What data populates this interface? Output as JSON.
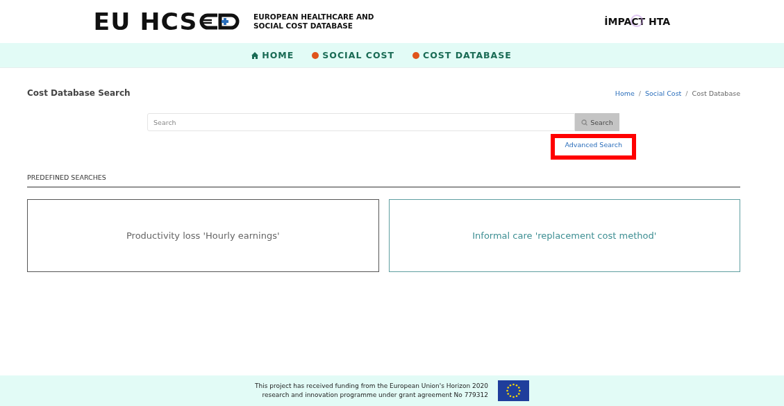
{
  "header": {
    "logo_text": "EU HCS",
    "logo_caption": [
      "EUROPEAN HEALTHCARE AND",
      "SOCIAL COST DATABASE"
    ],
    "partner_logo": "İMPACT HTA"
  },
  "nav": [
    {
      "label": "HOME",
      "kind": "home"
    },
    {
      "label": "SOCIAL COST",
      "kind": "dot"
    },
    {
      "label": "COST DATABASE",
      "kind": "dot"
    }
  ],
  "page_title": "Cost Database Search",
  "breadcrumb": [
    {
      "label": "Home",
      "current": false
    },
    {
      "label": "Social Cost",
      "current": false
    },
    {
      "label": "Cost Database",
      "current": true
    }
  ],
  "breadcrumb_separator": "/",
  "search": {
    "placeholder": "Search",
    "button": "Search",
    "advanced_link": "Advanced Search",
    "highlighted": true
  },
  "predefined": {
    "heading": "PREDEFINED SEARCHES",
    "cards": [
      {
        "label": "Productivity loss 'Hourly earnings'",
        "selected": false
      },
      {
        "label": "Informal care 'replacement cost method'",
        "selected": true
      }
    ]
  },
  "footer": {
    "lines": [
      "This project has received funding from the European Union's Horizon 2020",
      "research and innovation programme under grant agreement No 779312"
    ]
  }
}
